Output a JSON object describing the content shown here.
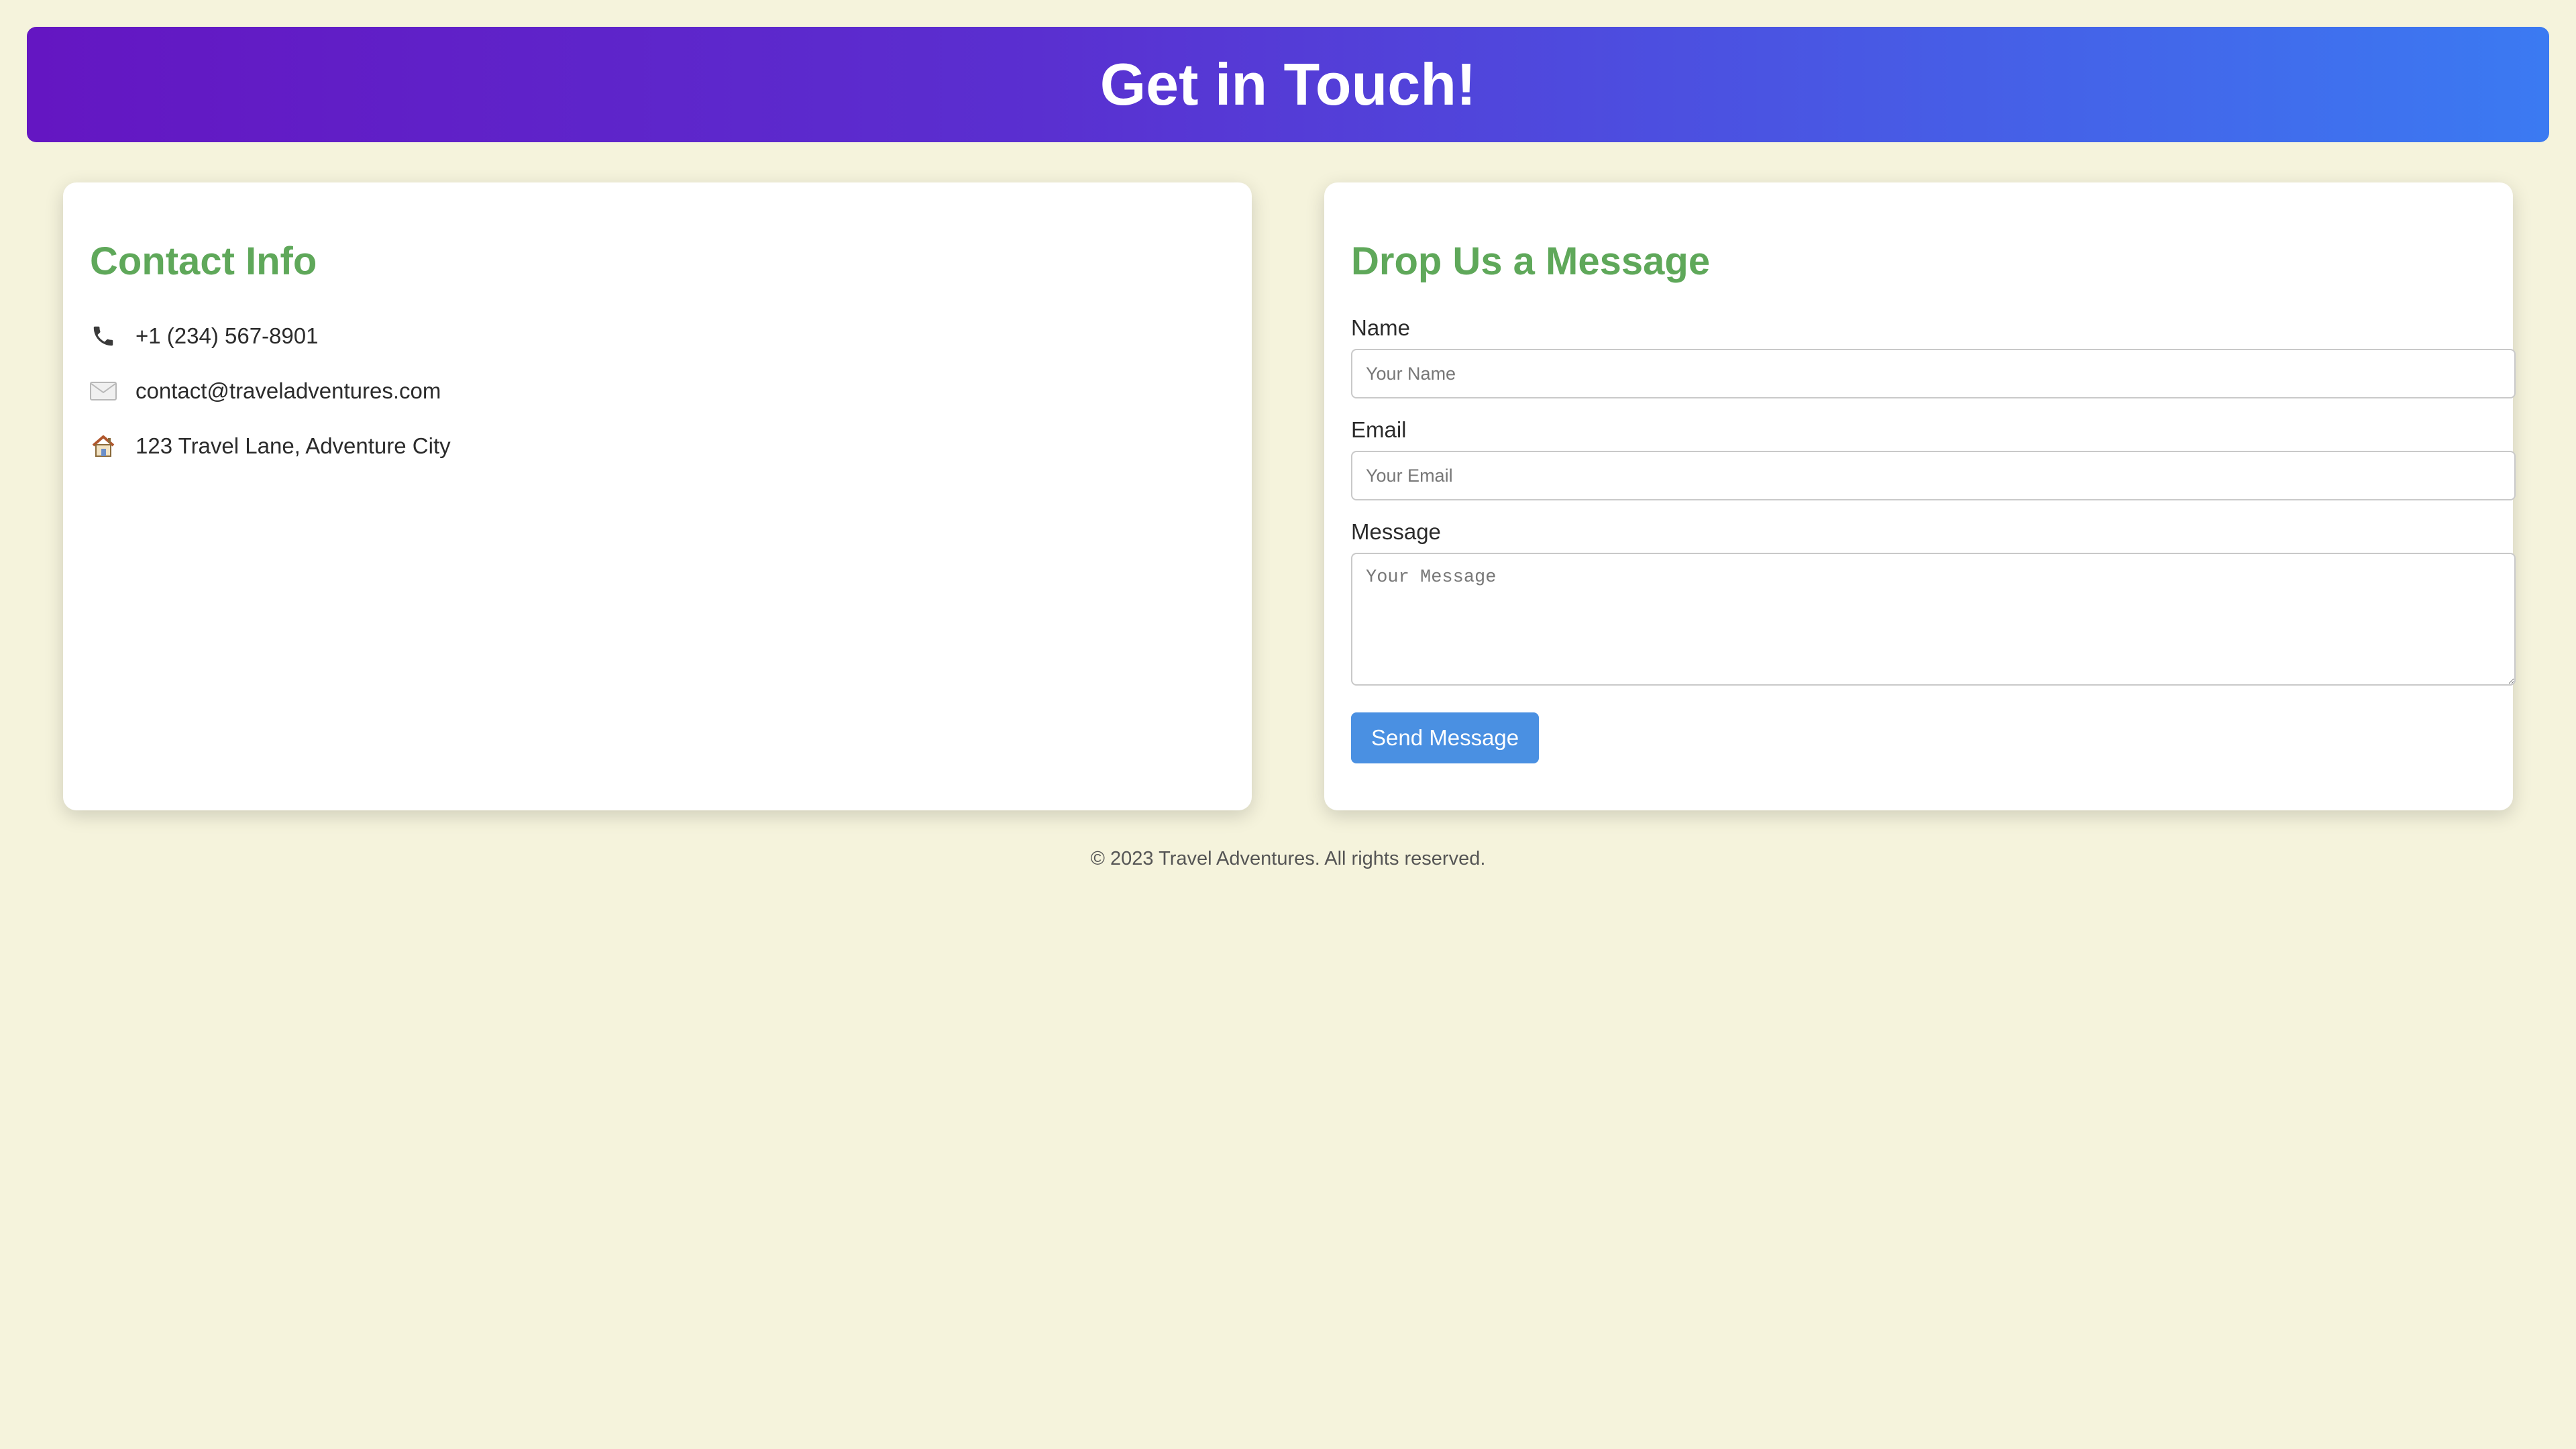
{
  "header": {
    "title": "Get in Touch!"
  },
  "contact_info": {
    "heading": "Contact Info",
    "items": [
      {
        "icon": "phone-icon",
        "text": "+1 (234) 567-8901"
      },
      {
        "icon": "envelope-icon",
        "text": "contact@traveladventures.com"
      },
      {
        "icon": "house-icon",
        "text": "123 Travel Lane, Adventure City"
      }
    ]
  },
  "message_form": {
    "heading": "Drop Us a Message",
    "name_label": "Name",
    "name_placeholder": "Your Name",
    "email_label": "Email",
    "email_placeholder": "Your Email",
    "message_label": "Message",
    "message_placeholder": "Your Message",
    "submit_label": "Send Message"
  },
  "footer": {
    "text": "© 2023 Travel Adventures. All rights reserved."
  },
  "colors": {
    "background": "#f5f3dc",
    "header_gradient_start": "#6416c2",
    "header_gradient_end": "#3b7af2",
    "heading_green": "#5fa85a",
    "button_blue": "#4a90e2"
  }
}
